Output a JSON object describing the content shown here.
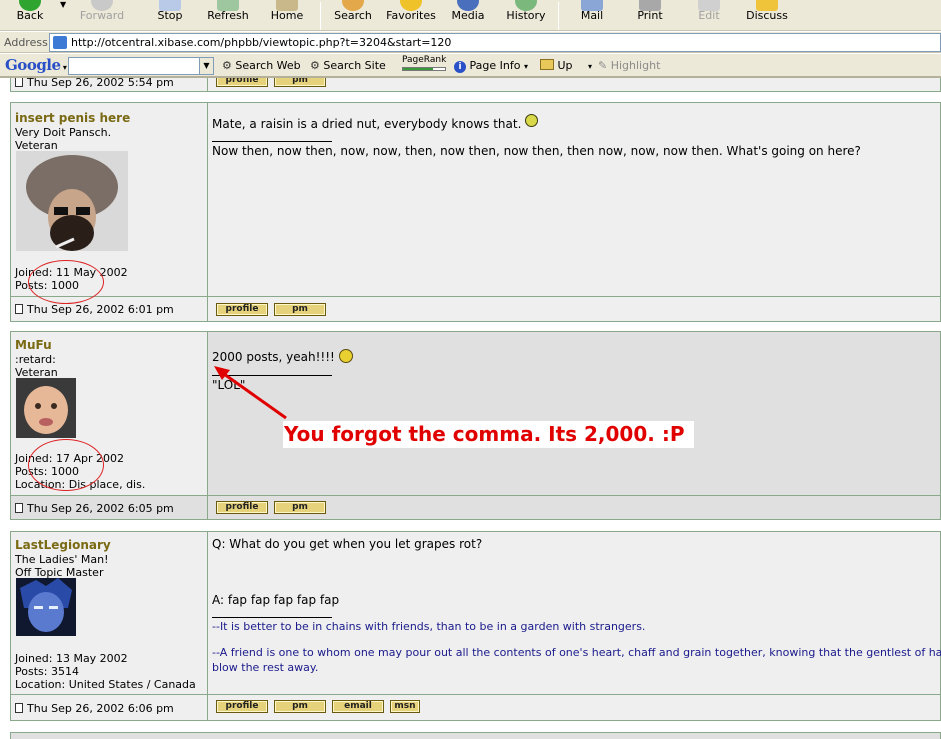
{
  "toolbar": {
    "back": "Back",
    "forward": "Forward",
    "stop": "Stop",
    "refresh": "Refresh",
    "home": "Home",
    "search": "Search",
    "favorites": "Favorites",
    "media": "Media",
    "history": "History",
    "mail": "Mail",
    "print": "Print",
    "edit": "Edit",
    "discuss": "Discuss"
  },
  "address": {
    "label": "Address",
    "url": "http://otcentral.xibase.com/phpbb/viewtopic.php?t=3204&start=120"
  },
  "google": {
    "logo": "Google",
    "search_web": "Search Web",
    "search_site": "Search Site",
    "pagerank": "PageRank",
    "page_info": "Page Info",
    "up": "Up",
    "highlight": "Highlight"
  },
  "posts": [
    {
      "date": "Thu Sep 26, 2002 5:54 pm"
    },
    {
      "user": "insert penis here",
      "title": "Very Doit Pansch.",
      "rank": "Veteran",
      "joined": "Joined: 11 May 2002",
      "posts": "Posts: 1000",
      "body1": "Mate, a raisin is a dried nut, everybody knows that.",
      "sig": "Now then, now then, now, now, then, now then, now then, then now, now, now then. What's going on here?",
      "date": "Thu Sep 26, 2002 6:01 pm"
    },
    {
      "user": "MuFu",
      "title": ":retard:",
      "rank": "Veteran",
      "joined": "Joined: 17 Apr 2002",
      "posts": "Posts: 1000",
      "location": "Location: Dis place, dis.",
      "body1": "2000 posts, yeah!!!!",
      "sig": "\"LOL\"",
      "date": "Thu Sep 26, 2002 6:05 pm"
    },
    {
      "user": "LastLegionary",
      "title": "The Ladies' Man!",
      "rank": "Off Topic Master",
      "joined": "Joined: 13 May 2002",
      "posts": "Posts: 3514",
      "location": "Location: United States / Canada",
      "body1": "Q: What do you get when you let grapes rot?",
      "body2": "A: fap fap fap fap fap",
      "sig1": "--It is better to be in chains with friends, than to be in a garden with strangers.",
      "sig2a": "--A friend is one to whom one may pour out all the contents of one's heart, chaff and grain together, knowing that the gentlest of hands will take and sift it,",
      "sig2b": "blow the rest away.",
      "date": "Thu Sep 26, 2002 6:06 pm"
    }
  ],
  "buttons": {
    "profile": "profile",
    "pm": "pm",
    "email": "email",
    "msn": "msn"
  },
  "annotation": "You forgot the comma.  Its 2,000. :P",
  "colors": {
    "annotation": "#e00000",
    "username": "#7a6a14",
    "signature": "#1a1a8c",
    "post_bg": "#efefef"
  }
}
